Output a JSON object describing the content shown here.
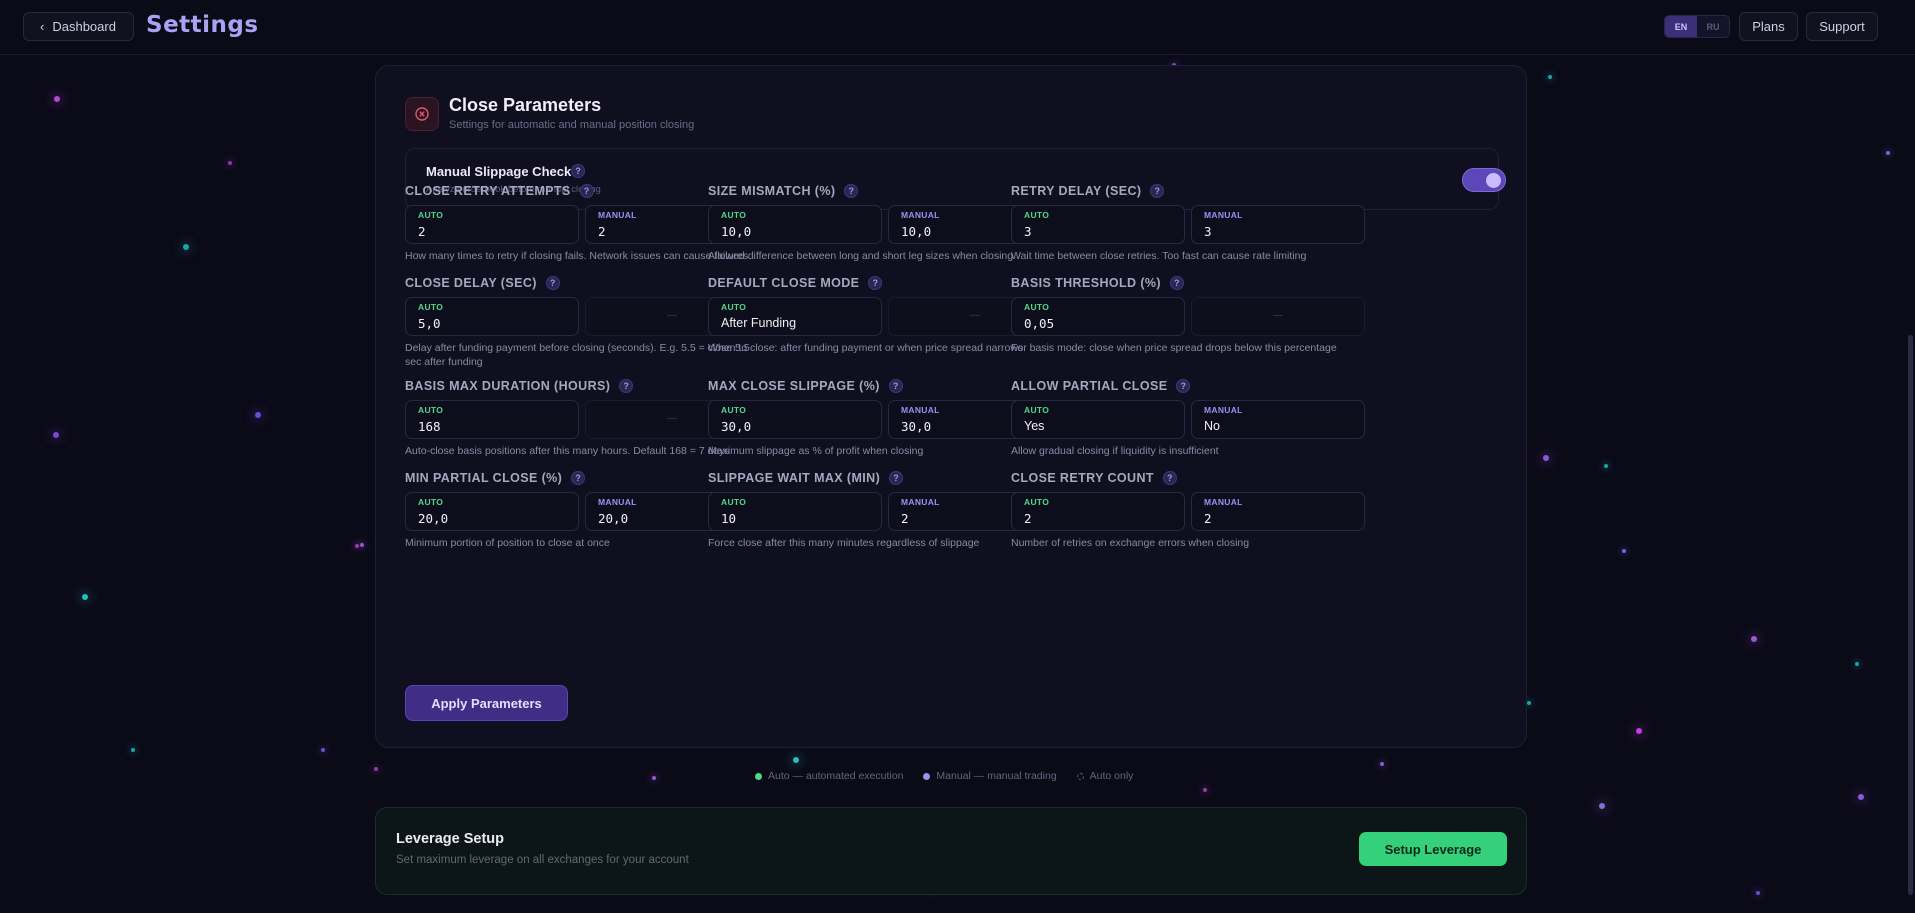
{
  "header": {
    "back_label": "Dashboard",
    "title": "Settings",
    "lang": [
      "EN",
      "RU"
    ],
    "lang_active": "EN",
    "plans_label": "Plans",
    "support_label": "Support"
  },
  "card": {
    "icon": "close-circle-icon",
    "title": "Close Parameters",
    "subtitle": "Settings for automatic and manual position closing",
    "toggle": {
      "title": "Manual Slippage Check",
      "subtitle": "Analyze orderbook before manual closing",
      "enabled": true
    },
    "auto_tag": "AUTO",
    "manual_tag": "MANUAL",
    "empty_dash": "—",
    "fields": [
      {
        "label": "CLOSE RETRY ATTEMPTS",
        "auto": "2",
        "manual": "2",
        "desc": "How many times to retry if closing fails. Network issues can cause failures"
      },
      {
        "label": "SIZE MISMATCH (%)",
        "auto": "10,0",
        "manual": "10,0",
        "desc": "Allowed difference between long and short leg sizes when closing"
      },
      {
        "label": "RETRY DELAY (SEC)",
        "auto": "3",
        "manual": "3",
        "desc": "Wait time between close retries. Too fast can cause rate limiting"
      },
      {
        "label": "CLOSE DELAY (SEC)",
        "auto": "5,0",
        "manual": null,
        "desc": "Delay after funding payment before closing (seconds). E.g. 5.5 = close 5.5 sec after funding"
      },
      {
        "label": "DEFAULT CLOSE MODE",
        "auto": "After Funding",
        "manual": null,
        "desc": "When to close: after funding payment or when price spread narrows"
      },
      {
        "label": "BASIS THRESHOLD (%)",
        "auto": "0,05",
        "manual": null,
        "desc": "For basis mode: close when price spread drops below this percentage"
      },
      {
        "label": "BASIS MAX DURATION (HOURS)",
        "auto": "168",
        "manual": null,
        "desc": "Auto-close basis positions after this many hours. Default 168 = 7 days"
      },
      {
        "label": "MAX CLOSE SLIPPAGE (%)",
        "auto": "30,0",
        "manual": "30,0",
        "desc": "Maximum slippage as % of profit when closing"
      },
      {
        "label": "ALLOW PARTIAL CLOSE",
        "auto": "Yes",
        "manual": "No",
        "desc": "Allow gradual closing if liquidity is insufficient"
      },
      {
        "label": "MIN PARTIAL CLOSE (%)",
        "auto": "20,0",
        "manual": "20,0",
        "desc": "Minimum portion of position to close at once"
      },
      {
        "label": "SLIPPAGE WAIT MAX (MIN)",
        "auto": "10",
        "manual": "2",
        "desc": "Force close after this many minutes regardless of slippage"
      },
      {
        "label": "CLOSE RETRY COUNT",
        "auto": "2",
        "manual": "2",
        "desc": "Number of retries on exchange errors when closing"
      }
    ],
    "apply_label": "Apply Parameters"
  },
  "legend": {
    "auto": "Auto — automated execution",
    "manual": "Manual — manual trading",
    "auto_only": "Auto only"
  },
  "leverage": {
    "title": "Leverage Setup",
    "subtitle": "Set maximum leverage on all exchanges for your account",
    "button_label": "Setup Leverage"
  },
  "colors": {
    "background": "#0b0a17",
    "accent": "#a9a2f5",
    "auto": "#4fd88a",
    "manual": "#9a92f0",
    "leverage_button": "#34d07a"
  }
}
